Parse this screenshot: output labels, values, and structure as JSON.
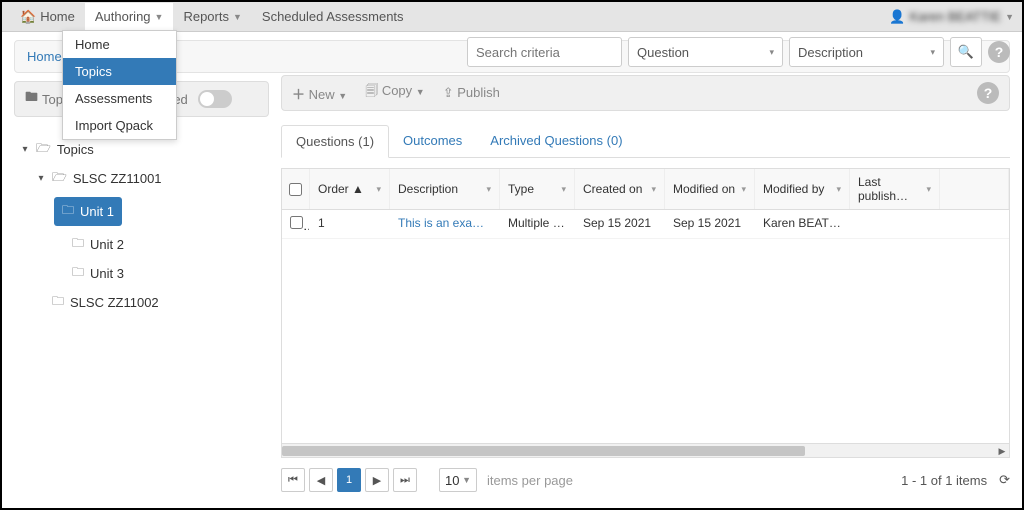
{
  "nav": {
    "home": "Home",
    "authoring": "Authoring",
    "reports": "Reports",
    "scheduled": "Scheduled Assessments",
    "user_name": "Karen BEATTIE"
  },
  "authoring_dropdown": {
    "home": "Home",
    "topics": "Topics",
    "assessments": "Assessments",
    "import_qpack": "Import Qpack"
  },
  "breadcrumb": {
    "home": "Home"
  },
  "left_toolbar": {
    "topics_btn": "Topics",
    "show_archived": "Show Archived"
  },
  "tree": {
    "root": "Topics",
    "course1": "SLSC ZZ11001",
    "unit1": "Unit 1",
    "unit2": "Unit 2",
    "unit3": "Unit 3",
    "course2": "SLSC ZZ11002"
  },
  "search": {
    "placeholder": "Search criteria",
    "field_select": "Question",
    "match_select": "Description"
  },
  "action_bar": {
    "new": "New",
    "copy": "Copy",
    "publish": "Publish"
  },
  "tabs": {
    "questions": "Questions  (1)",
    "outcomes": "Outcomes",
    "archived": "Archived Questions  (0)"
  },
  "grid": {
    "headers": {
      "order": "Order ▲",
      "description": "Description",
      "type": "Type",
      "created_on": "Created on",
      "modified_on": "Modified on",
      "modified_by": "Modified by",
      "last_published": "Last publish…"
    },
    "rows": [
      {
        "order": "1",
        "description": "This is an example q…",
        "type": "Multiple choice",
        "created_on": "Sep 15 2021",
        "modified_on": "Sep 15 2021",
        "modified_by": "Karen BEATTIE",
        "last_published": ""
      }
    ]
  },
  "pager": {
    "page": "1",
    "page_size": "10",
    "items_per_page": "items per page",
    "summary": "1 - 1 of 1 items"
  }
}
